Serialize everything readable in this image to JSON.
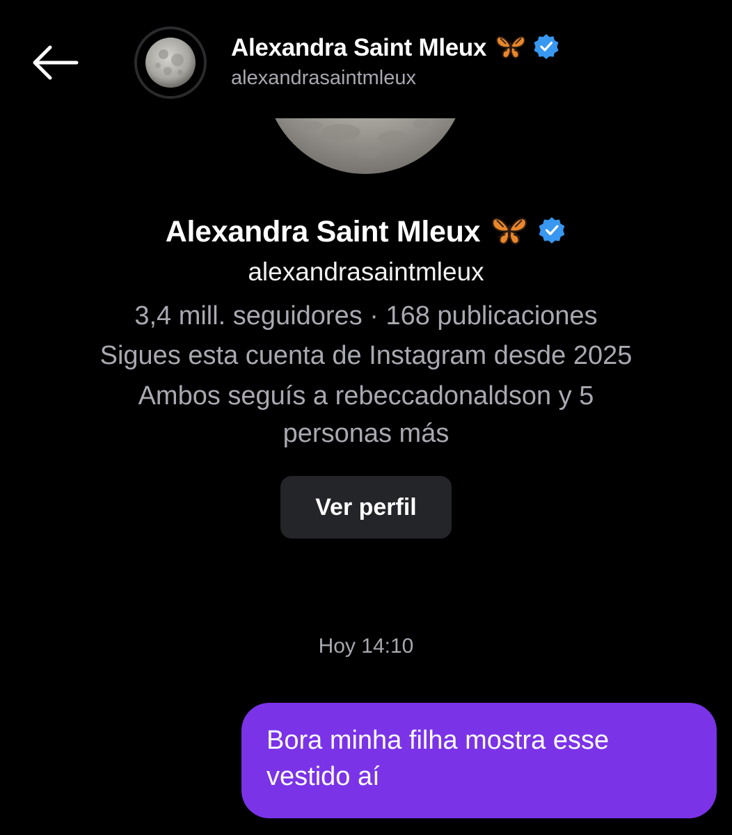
{
  "header": {
    "name": "Alexandra Saint Mleux",
    "handle": "alexandrasaintmleux",
    "back_icon": "arrow-left-icon",
    "emoji_icon": "butterfly-emoji-icon",
    "verified_icon": "verified-badge-icon"
  },
  "profile": {
    "name": "Alexandra Saint Mleux",
    "handle": "alexandrasaintmleux",
    "stats": "3,4 mill. seguidores · 168 publicaciones",
    "following_since": "Sigues esta cuenta de Instagram desde 2025",
    "mutual_line1": "Ambos seguís a rebeccadonaldson y 5",
    "mutual_line2": "personas más",
    "view_profile_label": "Ver perfil"
  },
  "chat": {
    "timestamp": "Hoy 14:10",
    "messages": [
      {
        "sender": "me",
        "line1": "Bora minha filha mostra esse",
        "line2": "vestido aí"
      }
    ]
  },
  "colors": {
    "background": "#000000",
    "bubble": "#7b33e8",
    "button": "#242529",
    "verified": "#3897f0",
    "secondary_text": "#a9a9b1"
  }
}
